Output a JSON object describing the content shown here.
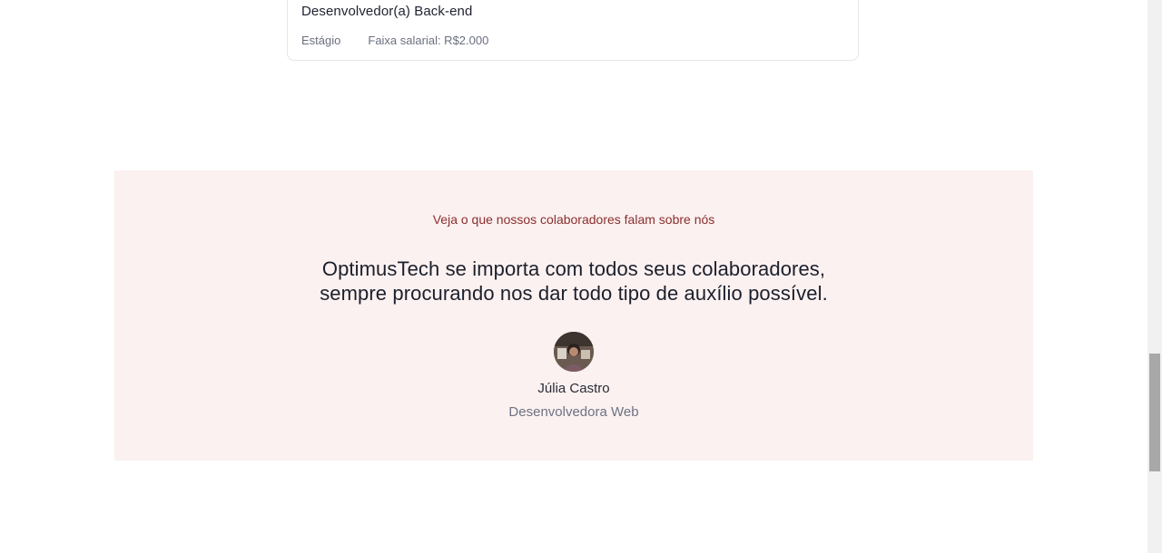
{
  "job_card": {
    "title": "Desenvolvedor(a) Back-end",
    "type": "Estágio",
    "salary": "Faixa salarial: R$2.000"
  },
  "testimonial": {
    "kicker": "Veja o que nossos colaboradores falam sobre nós",
    "quote_line1": "OptimusTech se importa com todos seus colaboradores,",
    "quote_line2": "sempre procurando nos dar todo tipo de auxílio possível.",
    "author_name": "Júlia Castro",
    "author_role": "Desenvolvedora Web"
  },
  "colors": {
    "section_background": "#fbf1f0",
    "kicker_color": "#8a2e2e",
    "text_dark": "#1c1f2c",
    "text_muted": "#6e7283"
  }
}
